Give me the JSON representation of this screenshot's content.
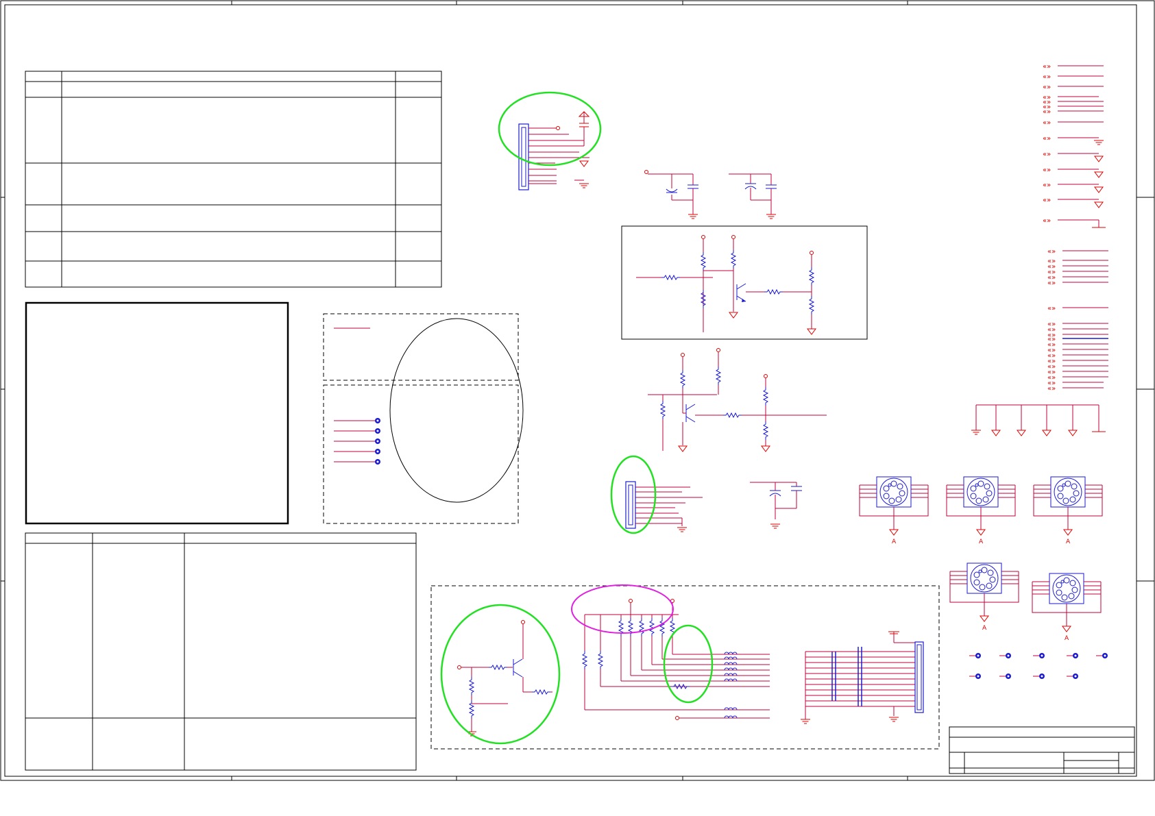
{
  "sheet": {
    "title_block": {
      "title": "",
      "number": "",
      "revision": ""
    },
    "revision_table": {
      "headers": [
        "",
        "",
        ""
      ],
      "rows": []
    },
    "notes_box": {
      "text": ""
    },
    "bom_table": {
      "headers": [
        "",
        "",
        ""
      ],
      "rows": []
    }
  },
  "colors": {
    "frame": "#000000",
    "wire": "#c0003a",
    "power_symbol": "#e00000",
    "component": "#1a1ad0",
    "annotation_green": "#22e022",
    "annotation_magenta": "#e020e0",
    "annotation_black": "#000000"
  },
  "annotations": [
    {
      "id": "left-connector-mark",
      "color": "annotation_green"
    },
    {
      "id": "dashed-boxes-mark",
      "color": "annotation_black"
    },
    {
      "id": "mid-connector-mark",
      "color": "annotation_green"
    },
    {
      "id": "transistor-mark",
      "color": "annotation_green"
    },
    {
      "id": "pullup-resistors-mark",
      "color": "annotation_magenta"
    },
    {
      "id": "filter-mark",
      "color": "annotation_green"
    }
  ]
}
